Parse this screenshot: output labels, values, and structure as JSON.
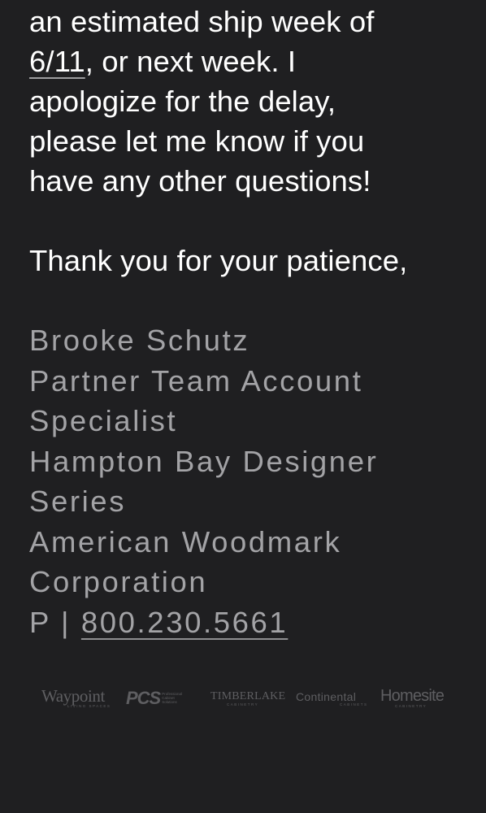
{
  "message": {
    "body_lines": [
      "an estimated ship week of",
      ", or next week. I",
      "apologize for the delay,",
      "please let me know if you",
      "have any other questions!"
    ],
    "date_link": "6/11",
    "closing": "Thank you for your patience,"
  },
  "signature": {
    "lines": [
      "Brooke Schutz",
      "Partner Team Account",
      "Specialist",
      "Hampton Bay Designer",
      "Series",
      "American Woodmark",
      "Corporation"
    ],
    "phone_prefix": "P | ",
    "phone": "800.230.5661"
  },
  "brand_logos": [
    {
      "name": "Waypoint",
      "tagline": "LIVING SPACES"
    },
    {
      "name": "PCS",
      "tagline": "Professional Cabinet Solutions"
    },
    {
      "name": "TIMBERLAKE",
      "tagline": "CABINETRY"
    },
    {
      "name": "Continental",
      "tagline": "CABINETS"
    },
    {
      "name": "Homesite",
      "tagline": "CABINETRY"
    }
  ],
  "colors": {
    "background": "#1f1f21",
    "body_text": "#ffffff",
    "signature_text": "#a3a3a6",
    "logo_gray": "#5e5e61"
  }
}
